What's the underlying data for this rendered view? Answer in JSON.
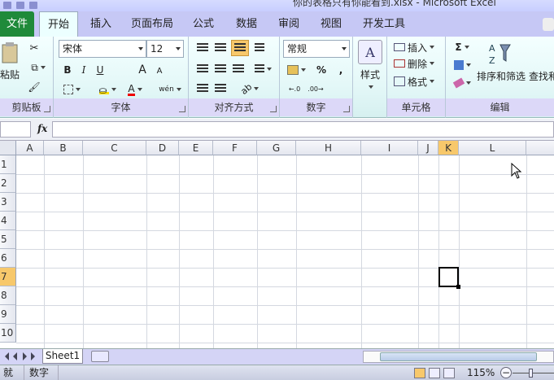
{
  "window": {
    "title": "你的表格只有你能看到.xlsx - Microsoft Excel"
  },
  "tabs": [
    {
      "label": "文件"
    },
    {
      "label": "开始"
    },
    {
      "label": "插入"
    },
    {
      "label": "页面布局"
    },
    {
      "label": "公式"
    },
    {
      "label": "数据"
    },
    {
      "label": "审阅"
    },
    {
      "label": "视图"
    },
    {
      "label": "开发工具"
    }
  ],
  "ribbon": {
    "clipboard": {
      "label": "剪贴板",
      "paste_label": "粘贴"
    },
    "font": {
      "label": "字体",
      "font_name": "宋体",
      "font_size": "12",
      "bold": "B",
      "italic": "I",
      "underline": "U",
      "grow": "A",
      "shrink": "A",
      "font_color": "A",
      "phonetic": "wén"
    },
    "alignment": {
      "label": "对齐方式"
    },
    "number": {
      "label": "数字",
      "format": "常规",
      "percent": "%",
      "comma": ","
    },
    "styles": {
      "label": "样式"
    },
    "cells": {
      "label": "单元格",
      "insert": "插入",
      "delete": "删除",
      "format": "格式"
    },
    "editing": {
      "label": "编辑",
      "sort_filter": "排序和筛选",
      "find": "查找和",
      "sigma": "Σ"
    }
  },
  "formula_bar": {
    "fx": "fx",
    "value": ""
  },
  "grid": {
    "columns": [
      "A",
      "B",
      "C",
      "D",
      "E",
      "F",
      "G",
      "H",
      "I",
      "J",
      "K",
      "L"
    ],
    "rows": [
      "1",
      "2",
      "3",
      "4",
      "5",
      "6",
      "7",
      "8",
      "9",
      "10"
    ],
    "selected_column": "K",
    "selected_row": "7"
  },
  "sheets": [
    {
      "name": "Sheet1"
    }
  ],
  "status": {
    "ready": "就绪",
    "mode": "数字",
    "zoom": "115%"
  }
}
